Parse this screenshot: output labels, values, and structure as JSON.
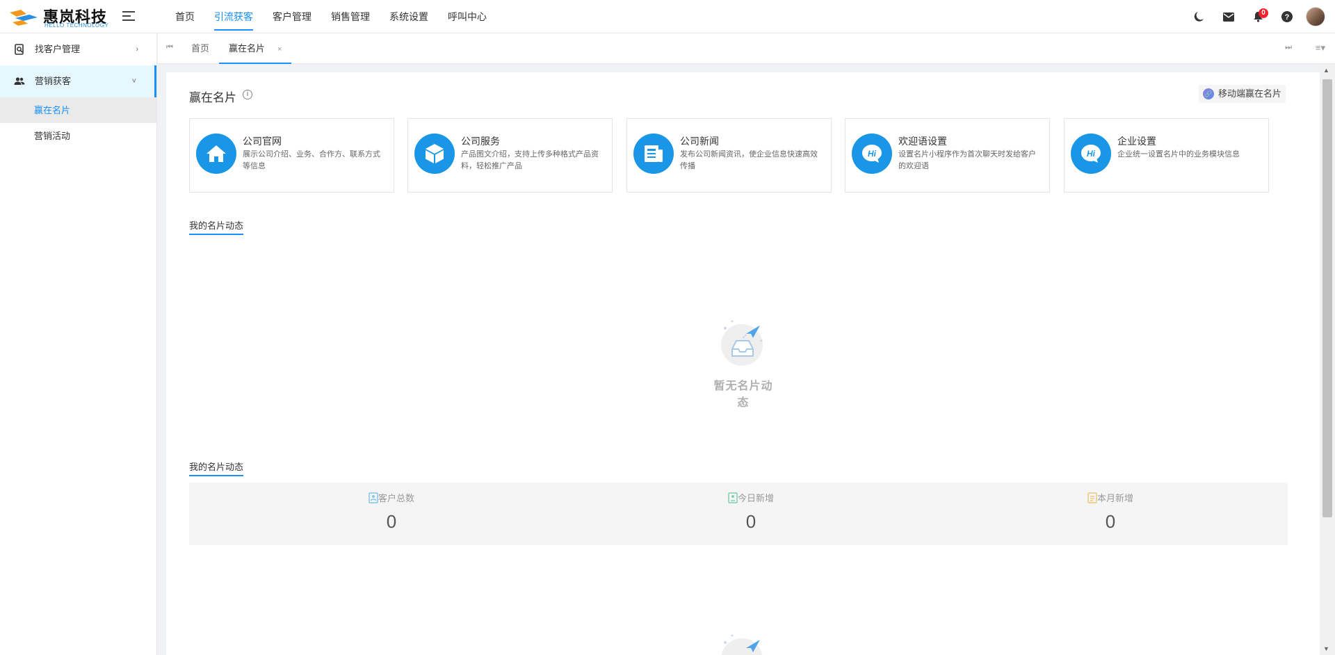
{
  "header": {
    "brand_name": "惠岚科技",
    "brand_sub": "HELLO TECHNOLOGY",
    "nav": [
      {
        "label": "首页",
        "active": false
      },
      {
        "label": "引流获客",
        "active": true
      },
      {
        "label": "客户管理",
        "active": false
      },
      {
        "label": "销售管理",
        "active": false
      },
      {
        "label": "系统设置",
        "active": false
      },
      {
        "label": "呼叫中心",
        "active": false
      }
    ],
    "icons": [
      "moon-icon",
      "mail-icon",
      "bell-icon",
      "help-icon"
    ],
    "notification_count": "0",
    "accent_color": "#1890ff"
  },
  "sidebar": {
    "items": [
      {
        "label": "找客户管理",
        "icon": "search-file-icon",
        "arrow": "›"
      },
      {
        "label": "营销获客",
        "icon": "users-icon",
        "arrow": "˅"
      }
    ],
    "sub_items": [
      {
        "label": "赢在名片",
        "active": true
      },
      {
        "label": "营销活动",
        "active": false
      }
    ]
  },
  "tabs": {
    "home": "首页",
    "current": "赢在名片",
    "close": "×"
  },
  "main": {
    "title": "赢在名片",
    "info_glyph": "i",
    "mobile_button": "移动端赢在名片",
    "cards": [
      {
        "title": "公司官网",
        "desc": "展示公司介绍、业务、合作方、联系方式等信息",
        "icon": "home-icon"
      },
      {
        "title": "公司服务",
        "desc": "产品图文介绍，支持上传多种格式产品资料，轻松推广产品",
        "icon": "box-icon"
      },
      {
        "title": "公司新闻",
        "desc": "发布公司新闻资讯，使企业信息快速高效传播",
        "icon": "news-icon"
      },
      {
        "title": "欢迎语设置",
        "desc": "设置名片小程序作为首次聊天时发给客户的欢迎语",
        "icon": "hi-chat-icon"
      },
      {
        "title": "企业设置",
        "desc": "企业统一设置名片中的业务模块信息",
        "icon": "hi-chat-icon"
      }
    ],
    "section1_title": "我的名片动态",
    "empty_text": "暂无名片动态",
    "section2_title": "我的名片动态",
    "stats": [
      {
        "label": "客户总数",
        "value": "0",
        "color": "#7ec8e8"
      },
      {
        "label": "今日新增",
        "value": "0",
        "color": "#7fd0b0"
      },
      {
        "label": "本月新增",
        "value": "0",
        "color": "#f2c879"
      }
    ]
  }
}
